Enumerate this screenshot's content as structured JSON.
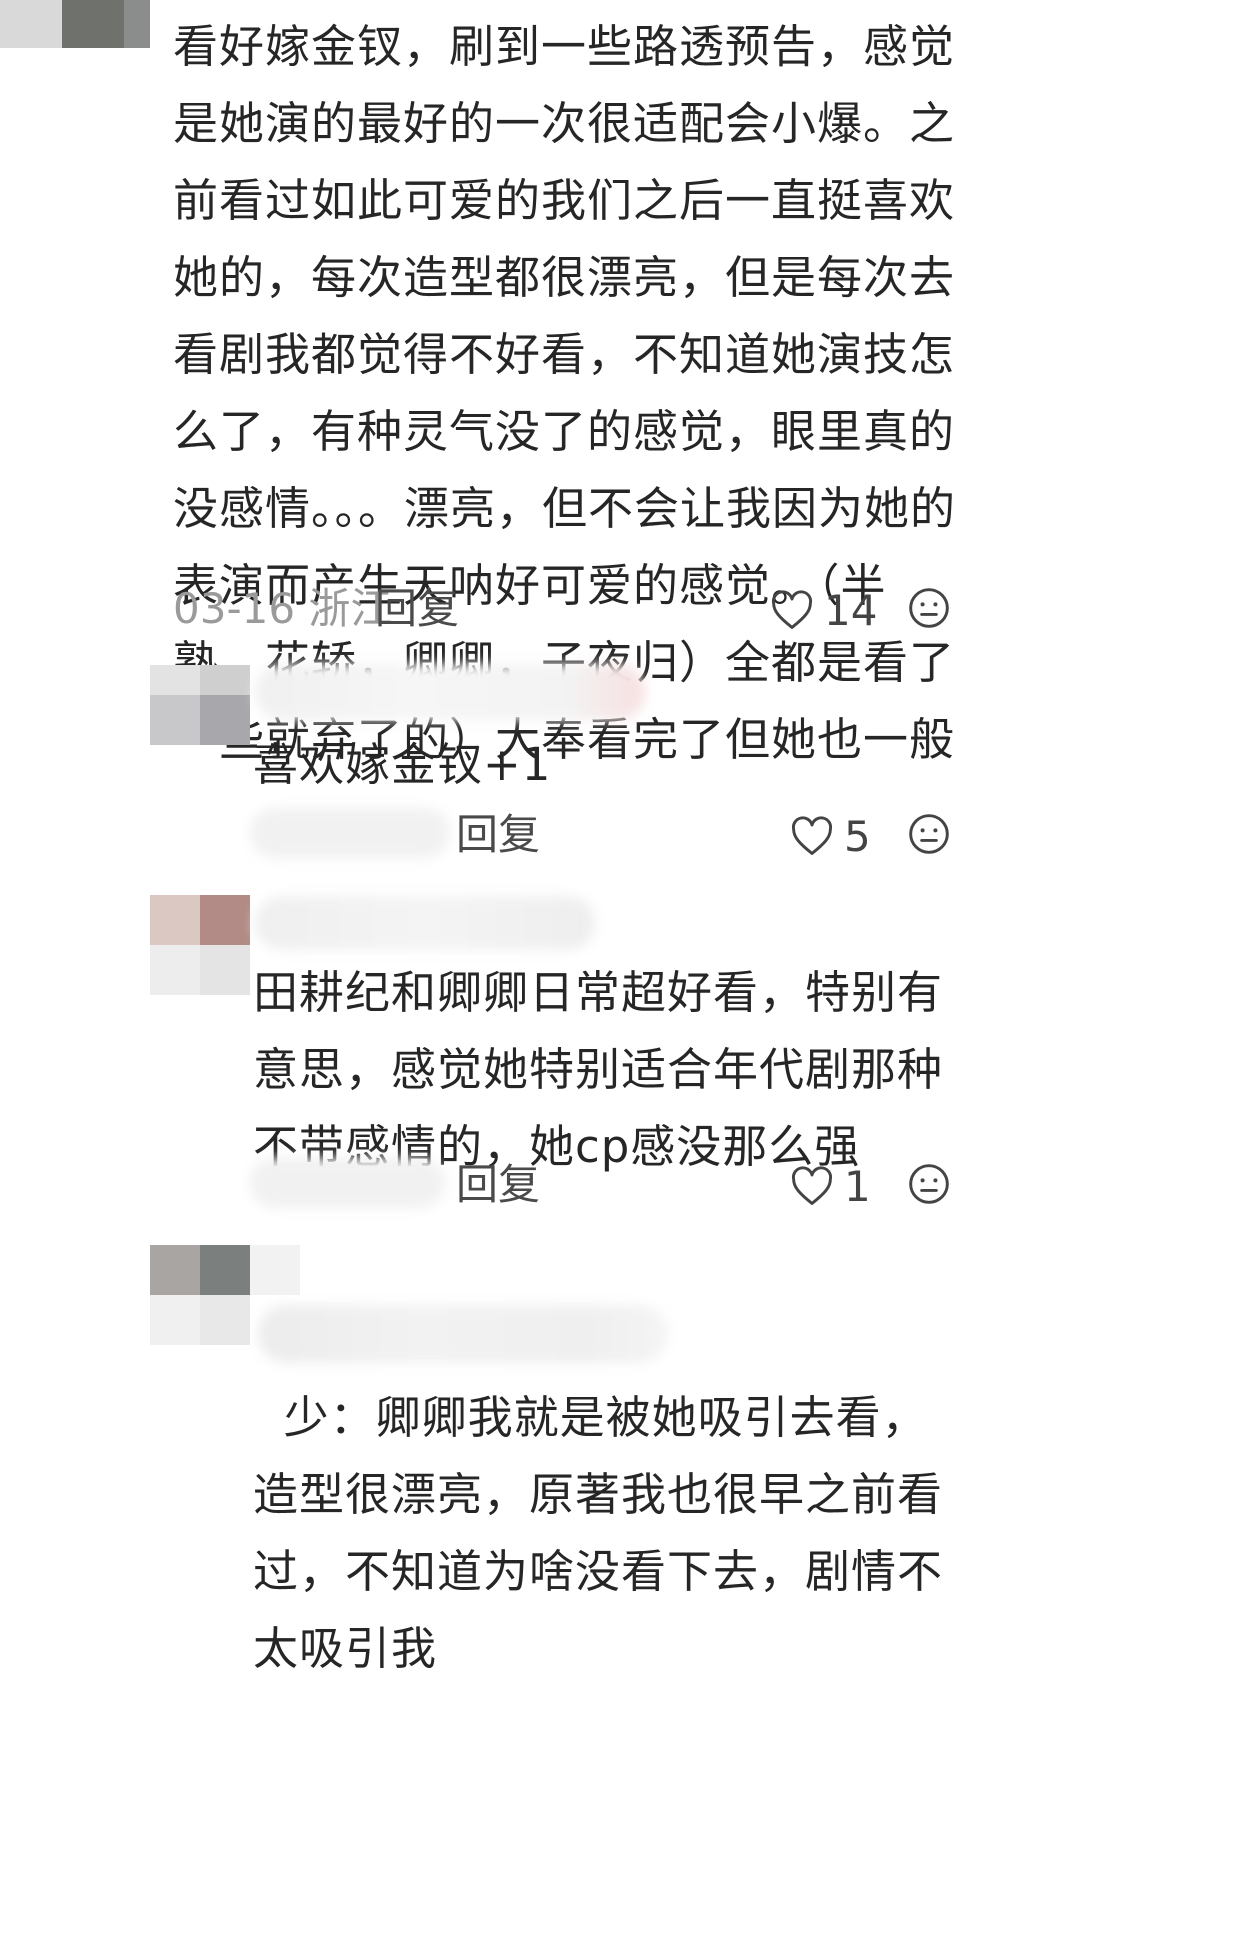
{
  "comments": [
    {
      "text": "看好嫁金钗，刷到一些路透预告，感觉是她演的最好的一次很适配会小爆。之前看过如此可爱的我们之后一直挺喜欢她的，每次造型都很漂亮，但是每次去看剧我都觉得不好看，不知道她演技怎么了，有种灵气没了的感觉，眼里真的没感情。。。漂亮，但不会让我因为她的表演而产生天呐好可爱的感觉。（半熟，花轿，卿卿，子夜归）全都是看了一些就弃了的）大奉看完了但她也一般",
      "date": "03-16",
      "location": "浙江",
      "reply_label": "回复",
      "likes": "14"
    },
    {
      "text": "喜欢嫁金钗+1",
      "reply_label": "回复",
      "likes": "5"
    },
    {
      "text": "田耕纪和卿卿日常超好看，特别有意思，感觉她特别适合年代剧那种不带感情的，她cp感没那么强",
      "reply_label": "回复",
      "likes": "1"
    },
    {
      "text_fragment": "少：卿卿我就是被她吸引去看，造型很漂亮，原著我也很早之前看过，不知道为啥没看下去，剧情不太吸引我"
    }
  ],
  "icons": {
    "like": "heart-outline-icon",
    "dislike": "neutral-face-icon"
  },
  "colors": {
    "text": "#262626",
    "meta": "#9a9a9a"
  }
}
